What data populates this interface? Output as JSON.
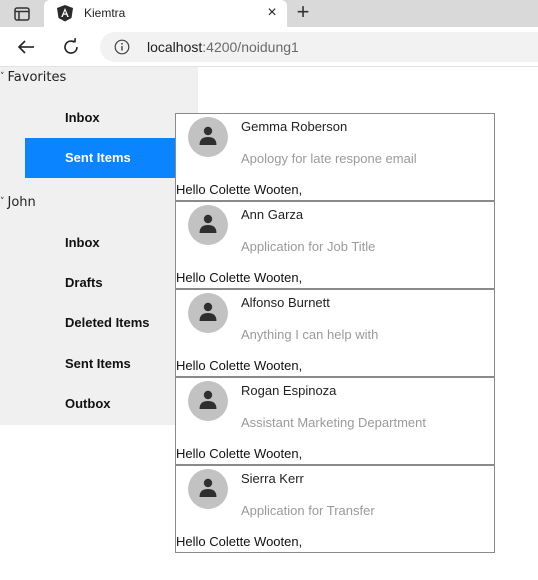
{
  "browser": {
    "tab_title": "Kiemtra",
    "close_glyph": "×",
    "new_tab_glyph": "+",
    "url_host": "localhost",
    "url_path": ":4200/noidung1",
    "icons": [
      "window-icon",
      "angular-logo-icon",
      "close-icon",
      "plus-icon",
      "back-arrow-icon",
      "reload-icon",
      "info-icon"
    ]
  },
  "sidebar": {
    "chevron": "˅",
    "groups": [
      {
        "label": "Favorites",
        "items": [
          "Inbox",
          "Sent Items"
        ],
        "active": "Sent Items"
      },
      {
        "label": "John",
        "items": [
          "Inbox",
          "Drafts",
          "Deleted Items",
          "Sent Items",
          "Outbox"
        ]
      }
    ],
    "active_color": "#0a84ff"
  },
  "emails": [
    {
      "sender": "Gemma Roberson",
      "subject": "Apology for late respone email",
      "greeting": "Hello Colette Wooten,"
    },
    {
      "sender": "Ann Garza",
      "subject": "Application for Job Title",
      "greeting": "Hello Colette Wooten,"
    },
    {
      "sender": "Alfonso Burnett",
      "subject": "Anything I can help with",
      "greeting": "Hello Colette Wooten,"
    },
    {
      "sender": "Rogan Espinoza",
      "subject": "Assistant Marketing Department",
      "greeting": "Hello Colette Wooten,"
    },
    {
      "sender": "Sierra Kerr",
      "subject": "Application for Transfer",
      "greeting": "Hello Colette Wooten,"
    }
  ]
}
